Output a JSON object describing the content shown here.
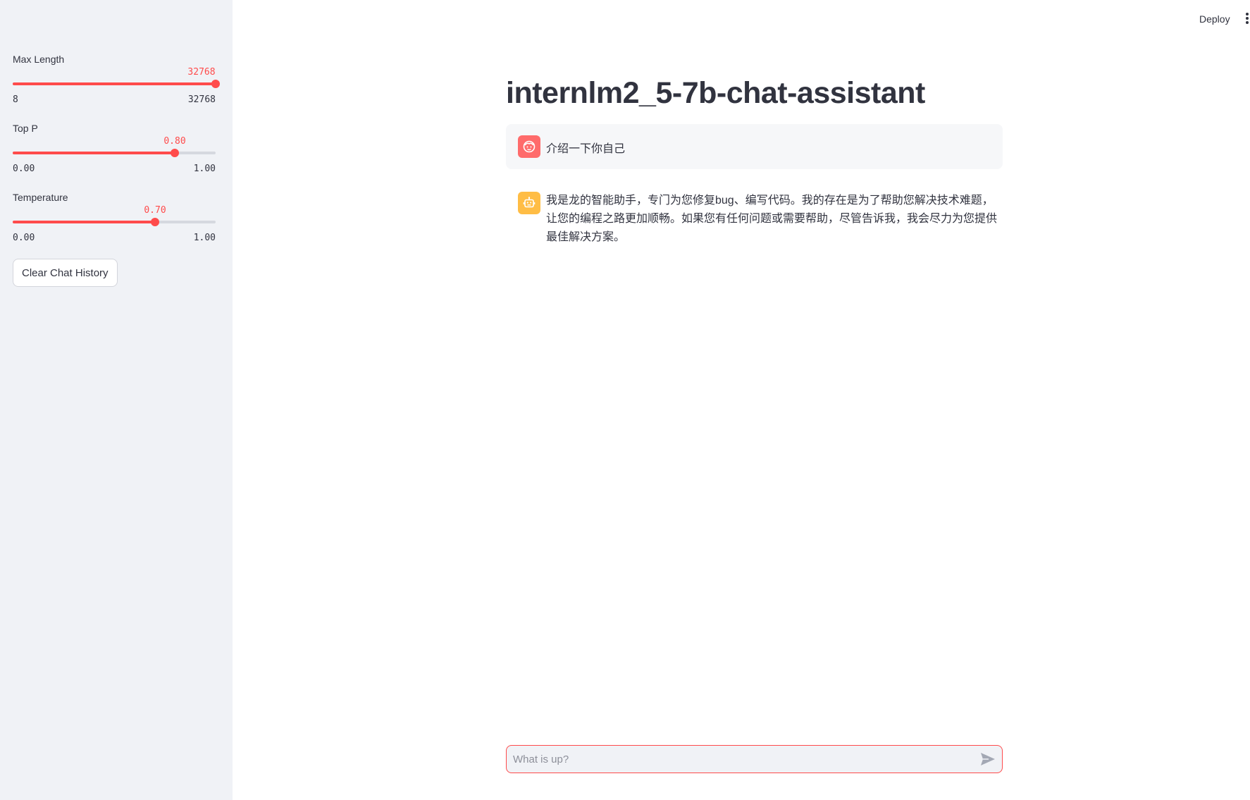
{
  "header": {
    "deploy_label": "Deploy",
    "menu_icon": "kebab-menu-icon"
  },
  "sidebar": {
    "sliders": [
      {
        "label": "Max Length",
        "value": "32768",
        "min": "8",
        "max": "32768",
        "fraction": 1.0
      },
      {
        "label": "Top P",
        "value": "0.80",
        "min": "0.00",
        "max": "1.00",
        "fraction": 0.8
      },
      {
        "label": "Temperature",
        "value": "0.70",
        "min": "0.00",
        "max": "1.00",
        "fraction": 0.7
      }
    ],
    "clear_button_label": "Clear Chat History"
  },
  "main": {
    "title": "internlm2_5-7b-chat-assistant",
    "messages": [
      {
        "role": "user",
        "avatar_icon": "user-face-icon",
        "text": "介绍一下你自己"
      },
      {
        "role": "assistant",
        "avatar_icon": "robot-icon",
        "text": "我是龙的智能助手，专门为您修复bug、编写代码。我的存在是为了帮助您解决技术难题，让您的编程之路更加顺畅。如果您有任何问题或需要帮助，尽管告诉我，我会尽力为您提供最佳解决方案。"
      }
    ]
  },
  "chat_input": {
    "placeholder": "What is up?",
    "value": "",
    "send_icon": "send-icon"
  },
  "colors": {
    "accent": "#ff4b4b",
    "sidebar_bg": "#f0f2f6",
    "user_avatar": "#ff6b6b",
    "bot_avatar": "#ffbd45",
    "text": "#31333f"
  }
}
